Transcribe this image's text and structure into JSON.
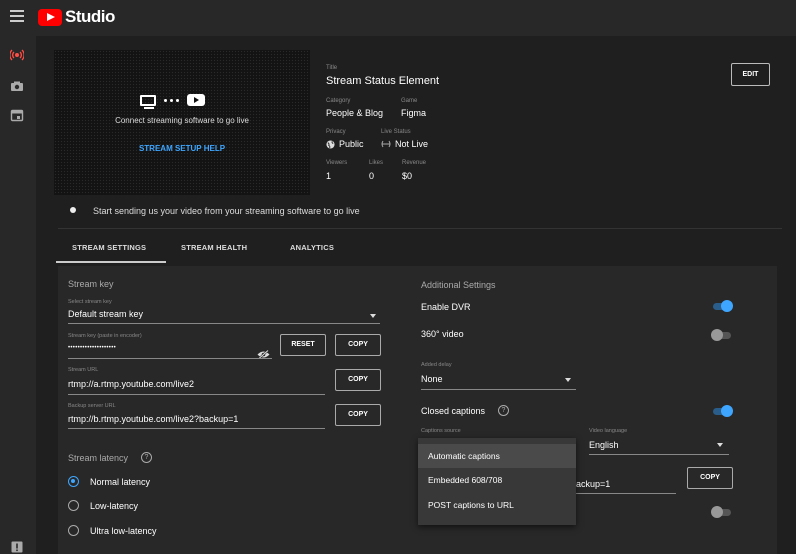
{
  "app": {
    "name": "Studio"
  },
  "preview": {
    "connect_text": "Connect streaming software to go live",
    "help_link": "STREAM SETUP HELP"
  },
  "details": {
    "title_label": "Title",
    "title": "Stream Status Element",
    "category_label": "Category",
    "category": "People & Blog",
    "game_label": "Game",
    "game": "Figma",
    "privacy_label": "Privacy",
    "privacy": "Public",
    "live_status_label": "Live Status",
    "live_status": "Not Live",
    "viewers_label": "Viewers",
    "viewers": "1",
    "likes_label": "Likes",
    "likes": "0",
    "revenue_label": "Revenue",
    "revenue": "$0",
    "edit_label": "EDIT"
  },
  "notice": "Start sending us your video from your streaming software to go live",
  "tabs": [
    {
      "label": "STREAM SETTINGS",
      "active": true
    },
    {
      "label": "STREAM HEALTH",
      "active": false
    },
    {
      "label": "ANALYTICS",
      "active": false
    }
  ],
  "stream_key": {
    "section_title": "Stream key",
    "select_label": "Select stream key",
    "select_value": "Default stream key",
    "key_label": "Stream key (paste in encoder)",
    "key_value": "••••••••••••••••••••",
    "reset_label": "RESET",
    "copy_label": "COPY",
    "url_label": "Stream URL",
    "url_value": "rtmp://a.rtmp.youtube.com/live2",
    "backup_label": "Backup server URL",
    "backup_value": "rtmp://b.rtmp.youtube.com/live2?backup=1"
  },
  "latency": {
    "section_title": "Stream latency",
    "options": [
      {
        "label": "Normal latency",
        "selected": true
      },
      {
        "label": "Low-latency",
        "selected": false
      },
      {
        "label": "Ultra low-latency",
        "selected": false
      }
    ]
  },
  "additional": {
    "section_title": "Additional Settings",
    "dvr_label": "Enable DVR",
    "dvr_on": true,
    "video360_label": "360° video",
    "video360_on": false,
    "delay_label": "Added delay",
    "delay_value": "None",
    "captions_label": "Closed captions",
    "captions_on": true,
    "captions_source_label": "Captions source",
    "video_language_label": "Video language",
    "video_language": "English",
    "partial_field_value": "ackup=1",
    "copy_label": "COPY",
    "bottom_toggle_on": false
  },
  "captions_menu": {
    "items": [
      {
        "label": "Automatic captions",
        "highlighted": true
      },
      {
        "label": "Embedded 608/708",
        "highlighted": false
      },
      {
        "label": "POST captions to URL",
        "highlighted": false
      }
    ]
  },
  "colors": {
    "accent": "#3ea6ff",
    "brand": "#ff0000",
    "background": "#1f1f1f",
    "panel": "#282828"
  }
}
